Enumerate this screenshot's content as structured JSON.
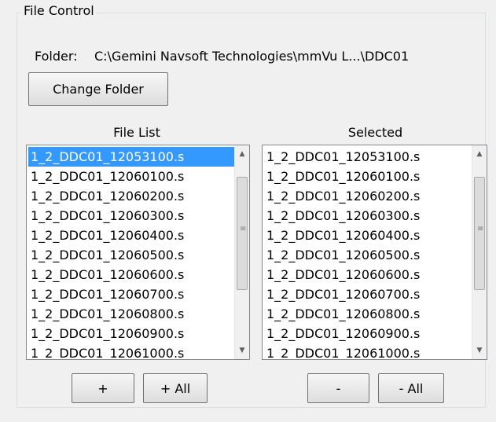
{
  "group": {
    "title": "File Control"
  },
  "folder": {
    "label": "Folder:",
    "path": "C:\\Gemini Navsoft Technologies\\mmVu L...\\DDC01"
  },
  "buttons": {
    "change_folder": "Change Folder",
    "add": "+",
    "add_all": "+ All",
    "remove": "-",
    "remove_all": "- All"
  },
  "file_list": {
    "title": "File List",
    "selected_index": 0,
    "items": [
      "1_2_DDC01_12053100.s",
      "1_2_DDC01_12060100.s",
      "1_2_DDC01_12060200.s",
      "1_2_DDC01_12060300.s",
      "1_2_DDC01_12060400.s",
      "1_2_DDC01_12060500.s",
      "1_2_DDC01_12060600.s",
      "1_2_DDC01_12060700.s",
      "1_2_DDC01_12060800.s",
      "1_2_DDC01_12060900.s",
      "1_2_DDC01_12061000.s"
    ]
  },
  "selected_list": {
    "title": "Selected",
    "items": [
      "1_2_DDC01_12053100.s",
      "1_2_DDC01_12060100.s",
      "1_2_DDC01_12060200.s",
      "1_2_DDC01_12060300.s",
      "1_2_DDC01_12060400.s",
      "1_2_DDC01_12060500.s",
      "1_2_DDC01_12060600.s",
      "1_2_DDC01_12060700.s",
      "1_2_DDC01_12060800.s",
      "1_2_DDC01_12060900.s",
      "1_2_DDC01_12061000.s"
    ]
  },
  "colors": {
    "selection": "#3399ff",
    "panel": "#f0f0f0"
  }
}
